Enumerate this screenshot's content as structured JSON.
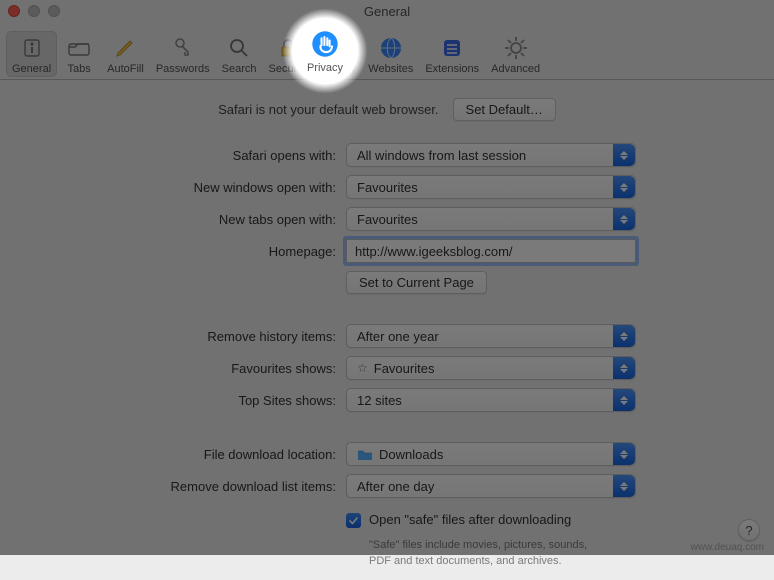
{
  "window": {
    "title": "General"
  },
  "toolbar": {
    "items": [
      {
        "id": "general",
        "label": "General",
        "selected": true
      },
      {
        "id": "tabs",
        "label": "Tabs"
      },
      {
        "id": "autofill",
        "label": "AutoFill"
      },
      {
        "id": "passwords",
        "label": "Passwords"
      },
      {
        "id": "search",
        "label": "Search"
      },
      {
        "id": "security",
        "label": "Security"
      },
      {
        "id": "privacy",
        "label": "Privacy"
      },
      {
        "id": "websites",
        "label": "Websites"
      },
      {
        "id": "extensions",
        "label": "Extensions"
      },
      {
        "id": "advanced",
        "label": "Advanced"
      }
    ]
  },
  "default_browser": {
    "text": "Safari is not your default web browser.",
    "button": "Set Default…"
  },
  "labels": {
    "opens_with": "Safari opens with:",
    "new_windows": "New windows open with:",
    "new_tabs": "New tabs open with:",
    "homepage": "Homepage:",
    "set_current": "Set to Current Page",
    "remove_history": "Remove history items:",
    "fav_shows": "Favourites shows:",
    "topsites": "Top Sites shows:",
    "download_loc": "File download location:",
    "remove_downloads": "Remove download list items:"
  },
  "values": {
    "opens_with": "All windows from last session",
    "new_windows": "Favourites",
    "new_tabs": "Favourites",
    "homepage": "http://www.igeeksblog.com/",
    "remove_history": "After one year",
    "fav_shows": "Favourites",
    "topsites": "12 sites",
    "download_loc": "Downloads",
    "remove_downloads": "After one day"
  },
  "safe_files": {
    "label": "Open \"safe\" files after downloading",
    "desc": "\"Safe\" files include movies, pictures, sounds, PDF and text documents, and archives.",
    "checked": true
  },
  "spotlight": {
    "label": "Privacy"
  },
  "help": "?",
  "watermark": "www.deuaq.com"
}
